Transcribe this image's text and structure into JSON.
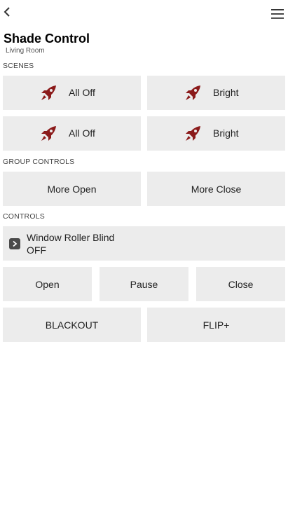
{
  "header": {
    "title": "Shade Control",
    "subtitle": "Living Room",
    "back_icon": "chevron-left-icon",
    "menu_icon": "hamburger-menu-icon"
  },
  "scenes": {
    "section_label": "SCENES",
    "items": [
      {
        "label": "All Off",
        "icon": "rocket-icon"
      },
      {
        "label": "Bright",
        "icon": "rocket-icon"
      },
      {
        "label": "All Off",
        "icon": "rocket-icon"
      },
      {
        "label": "Bright",
        "icon": "rocket-icon"
      }
    ],
    "icon_color": "#8b1a1a"
  },
  "group_controls": {
    "section_label": "GROUP CONTROLS",
    "more_open": "More Open",
    "more_close": "More Close"
  },
  "controls": {
    "section_label": "CONTROLS",
    "device": {
      "name": "Window Roller Blind",
      "state": "OFF",
      "expand_icon": "chevron-right-icon"
    },
    "open": "Open",
    "pause": "Pause",
    "close": "Close",
    "blackout": "BLACKOUT",
    "flip": "FLIP+"
  }
}
